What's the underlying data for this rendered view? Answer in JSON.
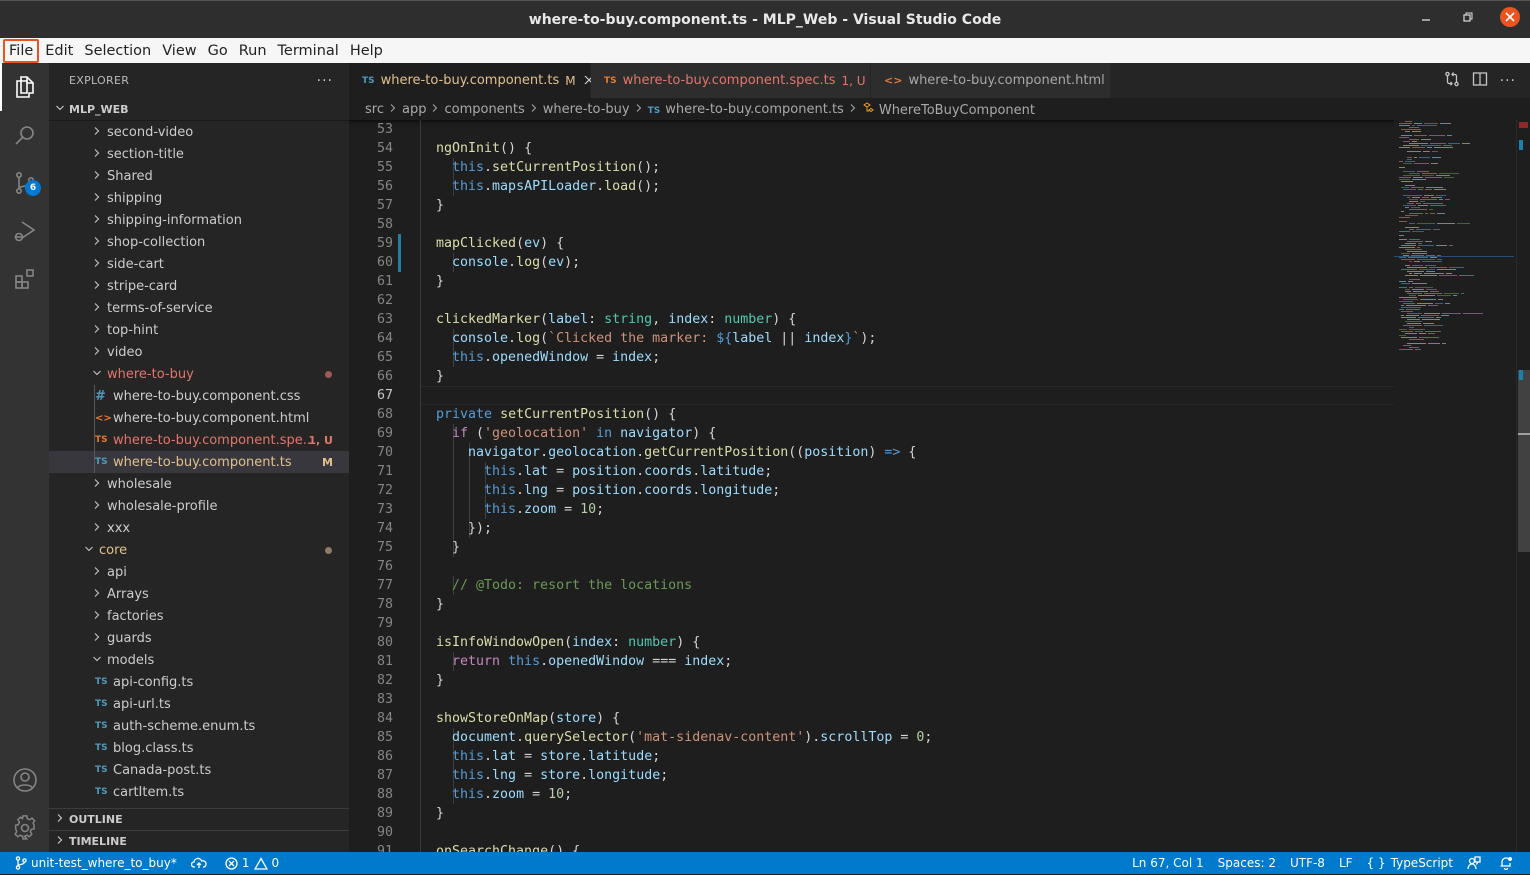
{
  "window": {
    "title": "where-to-buy.component.ts - MLP_Web - Visual Studio Code",
    "controls": [
      "minimize",
      "maximize",
      "close"
    ]
  },
  "menu": [
    {
      "label": "File",
      "focused": true
    },
    {
      "label": "Edit"
    },
    {
      "label": "Selection"
    },
    {
      "label": "View"
    },
    {
      "label": "Go"
    },
    {
      "label": "Run"
    },
    {
      "label": "Terminal"
    },
    {
      "label": "Help"
    }
  ],
  "activity_bar": {
    "items": [
      {
        "name": "explorer",
        "icon": "files-icon",
        "active": true
      },
      {
        "name": "search",
        "icon": "search-icon"
      },
      {
        "name": "source-control",
        "icon": "source-control-icon",
        "badge": "6"
      },
      {
        "name": "run-debug",
        "icon": "run-debug-icon"
      },
      {
        "name": "extensions",
        "icon": "extensions-icon"
      }
    ],
    "bottom": [
      {
        "name": "accounts",
        "icon": "account-icon"
      },
      {
        "name": "manage",
        "icon": "gear-icon"
      }
    ]
  },
  "sidebar": {
    "title": "EXPLORER",
    "more": "···",
    "root": "MLP_WEB",
    "tree": [
      {
        "label": "second-video",
        "type": "folder",
        "depth": 2,
        "open": false
      },
      {
        "label": "section-title",
        "type": "folder",
        "depth": 2,
        "open": false
      },
      {
        "label": "Shared",
        "type": "folder",
        "depth": 2,
        "open": false
      },
      {
        "label": "shipping",
        "type": "folder",
        "depth": 2,
        "open": false
      },
      {
        "label": "shipping-information",
        "type": "folder",
        "depth": 2,
        "open": false
      },
      {
        "label": "shop-collection",
        "type": "folder",
        "depth": 2,
        "open": false
      },
      {
        "label": "side-cart",
        "type": "folder",
        "depth": 2,
        "open": false
      },
      {
        "label": "stripe-card",
        "type": "folder",
        "depth": 2,
        "open": false
      },
      {
        "label": "terms-of-service",
        "type": "folder",
        "depth": 2,
        "open": false
      },
      {
        "label": "top-hint",
        "type": "folder",
        "depth": 2,
        "open": false
      },
      {
        "label": "video",
        "type": "folder",
        "depth": 2,
        "open": false
      },
      {
        "label": "where-to-buy",
        "type": "folder",
        "depth": 2,
        "open": true,
        "color": "#e2766a",
        "dot": "#9c5b56"
      },
      {
        "label": "where-to-buy.component.css",
        "type": "css",
        "depth": 3
      },
      {
        "label": "where-to-buy.component.html",
        "type": "html",
        "depth": 3
      },
      {
        "label": "where-to-buy.component.spe...",
        "type": "ts-spec",
        "depth": 3,
        "color": "#e2766a",
        "decoration": "1, U",
        "decoration_color": "#e2766a"
      },
      {
        "label": "where-to-buy.component.ts",
        "type": "ts",
        "depth": 3,
        "color": "#e2c08d",
        "decoration": "M",
        "decoration_color": "#e2c08d",
        "selected": true
      },
      {
        "label": "wholesale",
        "type": "folder",
        "depth": 2,
        "open": false
      },
      {
        "label": "wholesale-profile",
        "type": "folder",
        "depth": 2,
        "open": false
      },
      {
        "label": "xxx",
        "type": "folder",
        "depth": 2,
        "open": false
      },
      {
        "label": "core",
        "type": "folder",
        "depth": 1,
        "open": true,
        "color": "#e2c08d",
        "dot": "#8d7c63"
      },
      {
        "label": "api",
        "type": "folder",
        "depth": 2,
        "open": false
      },
      {
        "label": "Arrays",
        "type": "folder",
        "depth": 2,
        "open": false
      },
      {
        "label": "factories",
        "type": "folder",
        "depth": 2,
        "open": false
      },
      {
        "label": "guards",
        "type": "folder",
        "depth": 2,
        "open": false
      },
      {
        "label": "models",
        "type": "folder",
        "depth": 2,
        "open": true
      },
      {
        "label": "api-config.ts",
        "type": "ts",
        "depth": 3
      },
      {
        "label": "api-url.ts",
        "type": "ts",
        "depth": 3
      },
      {
        "label": "auth-scheme.enum.ts",
        "type": "ts",
        "depth": 3
      },
      {
        "label": "blog.class.ts",
        "type": "ts",
        "depth": 3
      },
      {
        "label": "Canada-post.ts",
        "type": "ts",
        "depth": 3
      },
      {
        "label": "cartItem.ts",
        "type": "ts",
        "depth": 3
      }
    ],
    "outline": "OUTLINE",
    "timeline": "TIMELINE"
  },
  "tabs": [
    {
      "label": "where-to-buy.component.ts",
      "icon": "TS",
      "icon_color": "#519aba",
      "color": "#e2c08d",
      "decoration": "M",
      "active": true,
      "closable": true
    },
    {
      "label": "where-to-buy.component.spec.ts",
      "icon": "TS",
      "icon_color": "#e37933",
      "color": "#e2766a",
      "decoration": "1, U"
    },
    {
      "label": "where-to-buy.component.html",
      "icon": "<>",
      "icon_color": "#e37933",
      "color": "#a8a8a8"
    }
  ],
  "tab_actions": [
    "open-changes-icon",
    "split-editor-icon",
    "more-actions-icon"
  ],
  "breadcrumb": [
    "src",
    "app",
    "components",
    "where-to-buy",
    "where-to-buy.component.ts",
    "WhereToBuyComponent"
  ],
  "editor": {
    "current_line": 67,
    "modified_lines": [
      59,
      60
    ],
    "lines": [
      {
        "n": 53,
        "indent": 0,
        "tokens": []
      },
      {
        "n": 54,
        "indent": 1,
        "tokens": [
          [
            "f",
            "ngOnInit"
          ],
          [
            "p",
            "() {"
          ]
        ]
      },
      {
        "n": 55,
        "indent": 2,
        "tokens": [
          [
            "k",
            "this"
          ],
          [
            "p",
            "."
          ],
          [
            "f",
            "setCurrentPosition"
          ],
          [
            "p",
            "();"
          ]
        ]
      },
      {
        "n": 56,
        "indent": 2,
        "tokens": [
          [
            "k",
            "this"
          ],
          [
            "p",
            "."
          ],
          [
            "v",
            "mapsAPILoader"
          ],
          [
            "p",
            "."
          ],
          [
            "f",
            "load"
          ],
          [
            "p",
            "();"
          ]
        ]
      },
      {
        "n": 57,
        "indent": 1,
        "tokens": [
          [
            "p",
            "}"
          ]
        ]
      },
      {
        "n": 58,
        "indent": 0,
        "tokens": []
      },
      {
        "n": 59,
        "indent": 1,
        "tokens": [
          [
            "f",
            "mapClicked"
          ],
          [
            "p",
            "("
          ],
          [
            "v",
            "ev"
          ],
          [
            "p",
            ") {"
          ]
        ]
      },
      {
        "n": 60,
        "indent": 2,
        "tokens": [
          [
            "v",
            "console"
          ],
          [
            "p",
            "."
          ],
          [
            "f",
            "log"
          ],
          [
            "p",
            "("
          ],
          [
            "v",
            "ev"
          ],
          [
            "p",
            ");"
          ]
        ]
      },
      {
        "n": 61,
        "indent": 1,
        "tokens": [
          [
            "p",
            "}"
          ]
        ]
      },
      {
        "n": 62,
        "indent": 0,
        "tokens": []
      },
      {
        "n": 63,
        "indent": 1,
        "tokens": [
          [
            "f",
            "clickedMarker"
          ],
          [
            "p",
            "("
          ],
          [
            "v",
            "label"
          ],
          [
            "p",
            ": "
          ],
          [
            "t",
            "string"
          ],
          [
            "p",
            ", "
          ],
          [
            "v",
            "index"
          ],
          [
            "p",
            ": "
          ],
          [
            "t",
            "number"
          ],
          [
            "p",
            ") {"
          ]
        ]
      },
      {
        "n": 64,
        "indent": 2,
        "tokens": [
          [
            "v",
            "console"
          ],
          [
            "p",
            "."
          ],
          [
            "f",
            "log"
          ],
          [
            "p",
            "("
          ],
          [
            "s",
            "`Clicked the marker: "
          ],
          [
            "k",
            "${"
          ],
          [
            "v",
            "label"
          ],
          [
            "p",
            " || "
          ],
          [
            "v",
            "index"
          ],
          [
            "k",
            "}"
          ],
          [
            "s",
            "`"
          ],
          [
            "p",
            ");"
          ]
        ]
      },
      {
        "n": 65,
        "indent": 2,
        "tokens": [
          [
            "k",
            "this"
          ],
          [
            "p",
            "."
          ],
          [
            "v",
            "openedWindow"
          ],
          [
            "p",
            " = "
          ],
          [
            "v",
            "index"
          ],
          [
            "p",
            ";"
          ]
        ]
      },
      {
        "n": 66,
        "indent": 1,
        "tokens": [
          [
            "p",
            "}"
          ]
        ]
      },
      {
        "n": 67,
        "indent": 0,
        "tokens": []
      },
      {
        "n": 68,
        "indent": 1,
        "tokens": [
          [
            "k",
            "private"
          ],
          [
            "p",
            " "
          ],
          [
            "f",
            "setCurrentPosition"
          ],
          [
            "p",
            "() {"
          ]
        ]
      },
      {
        "n": 69,
        "indent": 2,
        "tokens": [
          [
            "c",
            "if"
          ],
          [
            "p",
            " ("
          ],
          [
            "s",
            "'geolocation'"
          ],
          [
            "p",
            " "
          ],
          [
            "k",
            "in"
          ],
          [
            "p",
            " "
          ],
          [
            "v",
            "navigator"
          ],
          [
            "p",
            ") {"
          ]
        ]
      },
      {
        "n": 70,
        "indent": 3,
        "tokens": [
          [
            "v",
            "navigator"
          ],
          [
            "p",
            "."
          ],
          [
            "v",
            "geolocation"
          ],
          [
            "p",
            "."
          ],
          [
            "f",
            "getCurrentPosition"
          ],
          [
            "p",
            "(("
          ],
          [
            "v",
            "position"
          ],
          [
            "p",
            ") "
          ],
          [
            "k",
            "=>"
          ],
          [
            "p",
            " {"
          ]
        ]
      },
      {
        "n": 71,
        "indent": 4,
        "tokens": [
          [
            "k",
            "this"
          ],
          [
            "p",
            "."
          ],
          [
            "v",
            "lat"
          ],
          [
            "p",
            " = "
          ],
          [
            "v",
            "position"
          ],
          [
            "p",
            "."
          ],
          [
            "v",
            "coords"
          ],
          [
            "p",
            "."
          ],
          [
            "v",
            "latitude"
          ],
          [
            "p",
            ";"
          ]
        ]
      },
      {
        "n": 72,
        "indent": 4,
        "tokens": [
          [
            "k",
            "this"
          ],
          [
            "p",
            "."
          ],
          [
            "v",
            "lng"
          ],
          [
            "p",
            " = "
          ],
          [
            "v",
            "position"
          ],
          [
            "p",
            "."
          ],
          [
            "v",
            "coords"
          ],
          [
            "p",
            "."
          ],
          [
            "v",
            "longitude"
          ],
          [
            "p",
            ";"
          ]
        ]
      },
      {
        "n": 73,
        "indent": 4,
        "tokens": [
          [
            "k",
            "this"
          ],
          [
            "p",
            "."
          ],
          [
            "v",
            "zoom"
          ],
          [
            "p",
            " = "
          ],
          [
            "n",
            "10"
          ],
          [
            "p",
            ";"
          ]
        ]
      },
      {
        "n": 74,
        "indent": 3,
        "tokens": [
          [
            "p",
            "});"
          ]
        ]
      },
      {
        "n": 75,
        "indent": 2,
        "tokens": [
          [
            "p",
            "}"
          ]
        ]
      },
      {
        "n": 76,
        "indent": 0,
        "tokens": []
      },
      {
        "n": 77,
        "indent": 2,
        "tokens": [
          [
            "cm",
            "// @Todo: resort the locations"
          ]
        ]
      },
      {
        "n": 78,
        "indent": 1,
        "tokens": [
          [
            "p",
            "}"
          ]
        ]
      },
      {
        "n": 79,
        "indent": 0,
        "tokens": []
      },
      {
        "n": 80,
        "indent": 1,
        "tokens": [
          [
            "f",
            "isInfoWindowOpen"
          ],
          [
            "p",
            "("
          ],
          [
            "v",
            "index"
          ],
          [
            "p",
            ": "
          ],
          [
            "t",
            "number"
          ],
          [
            "p",
            ") {"
          ]
        ]
      },
      {
        "n": 81,
        "indent": 2,
        "tokens": [
          [
            "c",
            "return"
          ],
          [
            "p",
            " "
          ],
          [
            "k",
            "this"
          ],
          [
            "p",
            "."
          ],
          [
            "v",
            "openedWindow"
          ],
          [
            "p",
            " === "
          ],
          [
            "v",
            "index"
          ],
          [
            "p",
            ";"
          ]
        ]
      },
      {
        "n": 82,
        "indent": 1,
        "tokens": [
          [
            "p",
            "}"
          ]
        ]
      },
      {
        "n": 83,
        "indent": 0,
        "tokens": []
      },
      {
        "n": 84,
        "indent": 1,
        "tokens": [
          [
            "f",
            "showStoreOnMap"
          ],
          [
            "p",
            "("
          ],
          [
            "v",
            "store"
          ],
          [
            "p",
            ") {"
          ]
        ]
      },
      {
        "n": 85,
        "indent": 2,
        "tokens": [
          [
            "v",
            "document"
          ],
          [
            "p",
            "."
          ],
          [
            "f",
            "querySelector"
          ],
          [
            "p",
            "("
          ],
          [
            "s",
            "'mat-sidenav-content'"
          ],
          [
            "p",
            ")."
          ],
          [
            "v",
            "scrollTop"
          ],
          [
            "p",
            " = "
          ],
          [
            "n",
            "0"
          ],
          [
            "p",
            ";"
          ]
        ]
      },
      {
        "n": 86,
        "indent": 2,
        "tokens": [
          [
            "k",
            "this"
          ],
          [
            "p",
            "."
          ],
          [
            "v",
            "lat"
          ],
          [
            "p",
            " = "
          ],
          [
            "v",
            "store"
          ],
          [
            "p",
            "."
          ],
          [
            "v",
            "latitude"
          ],
          [
            "p",
            ";"
          ]
        ]
      },
      {
        "n": 87,
        "indent": 2,
        "tokens": [
          [
            "k",
            "this"
          ],
          [
            "p",
            "."
          ],
          [
            "v",
            "lng"
          ],
          [
            "p",
            " = "
          ],
          [
            "v",
            "store"
          ],
          [
            "p",
            "."
          ],
          [
            "v",
            "longitude"
          ],
          [
            "p",
            ";"
          ]
        ]
      },
      {
        "n": 88,
        "indent": 2,
        "tokens": [
          [
            "k",
            "this"
          ],
          [
            "p",
            "."
          ],
          [
            "v",
            "zoom"
          ],
          [
            "p",
            " = "
          ],
          [
            "n",
            "10"
          ],
          [
            "p",
            ";"
          ]
        ]
      },
      {
        "n": 89,
        "indent": 1,
        "tokens": [
          [
            "p",
            "}"
          ]
        ]
      },
      {
        "n": 90,
        "indent": 0,
        "tokens": []
      },
      {
        "n": 91,
        "indent": 1,
        "tokens": [
          [
            "f",
            "onSearchChange"
          ],
          [
            "p",
            "() {"
          ]
        ]
      }
    ]
  },
  "statusbar": {
    "branch": "unit-test_where_to_buy*",
    "sync_icon": "cloud-upload-icon",
    "errors": "1",
    "warnings": "0",
    "cursor": "Ln 67, Col 1",
    "indent": "Spaces: 2",
    "encoding": "UTF-8",
    "eol": "LF",
    "language": "TypeScript",
    "language_icon": "{ }",
    "feedback_icon": "feedback-icon",
    "notifications_icon": "bell-dot-icon"
  }
}
